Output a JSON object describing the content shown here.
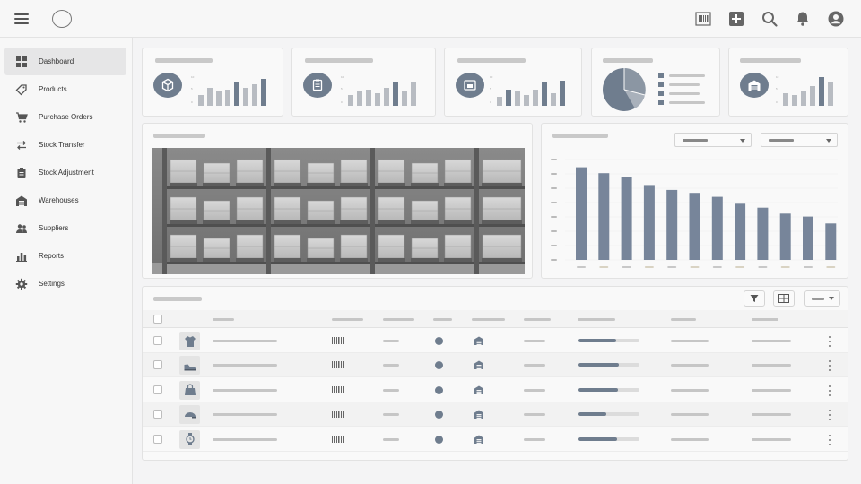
{
  "sidebar": {
    "items": [
      {
        "label": "Dashboard",
        "icon": "dashboard-icon",
        "active": true
      },
      {
        "label": "Products",
        "icon": "tag-icon",
        "active": false
      },
      {
        "label": "Purchase Orders",
        "icon": "cart-icon",
        "active": false
      },
      {
        "label": "Stock Transfer",
        "icon": "transfer-arrows-icon",
        "active": false
      },
      {
        "label": "Stock Adjustment",
        "icon": "clipboard-icon",
        "active": false
      },
      {
        "label": "Warehouses",
        "icon": "warehouse-icon",
        "active": false
      },
      {
        "label": "Suppliers",
        "icon": "people-icon",
        "active": false
      },
      {
        "label": "Reports",
        "icon": "bar-chart-icon",
        "active": false
      },
      {
        "label": "Settings",
        "icon": "gear-icon",
        "active": false
      }
    ]
  },
  "topbar": {
    "icons": [
      "barcode-scan-icon",
      "add-square-icon",
      "search-icon",
      "bell-icon",
      "account-icon"
    ]
  },
  "stat_cards": [
    {
      "icon": "box-icon"
    },
    {
      "icon": "clipboard-icon"
    },
    {
      "icon": "folder-icon"
    },
    {
      "icon": "pie-chart-icon"
    },
    {
      "icon": "warehouse-icon"
    }
  ],
  "table": {
    "rows": [
      {
        "product_icon": "tshirt-icon",
        "progress": 0.62
      },
      {
        "product_icon": "shoe-icon",
        "progress": 0.66
      },
      {
        "product_icon": "handbag-icon",
        "progress": 0.64
      },
      {
        "product_icon": "cap-icon",
        "progress": 0.45
      },
      {
        "product_icon": "watch-icon",
        "progress": 0.63
      }
    ]
  },
  "colors": {
    "accent": "#6f7d8e",
    "background": "#f4f4f5",
    "surface": "#f9f9f9"
  },
  "chart_data": {
    "type": "bar",
    "values": [
      94,
      88,
      84,
      76,
      71,
      68,
      64,
      57,
      53,
      47,
      44,
      37
    ]
  }
}
